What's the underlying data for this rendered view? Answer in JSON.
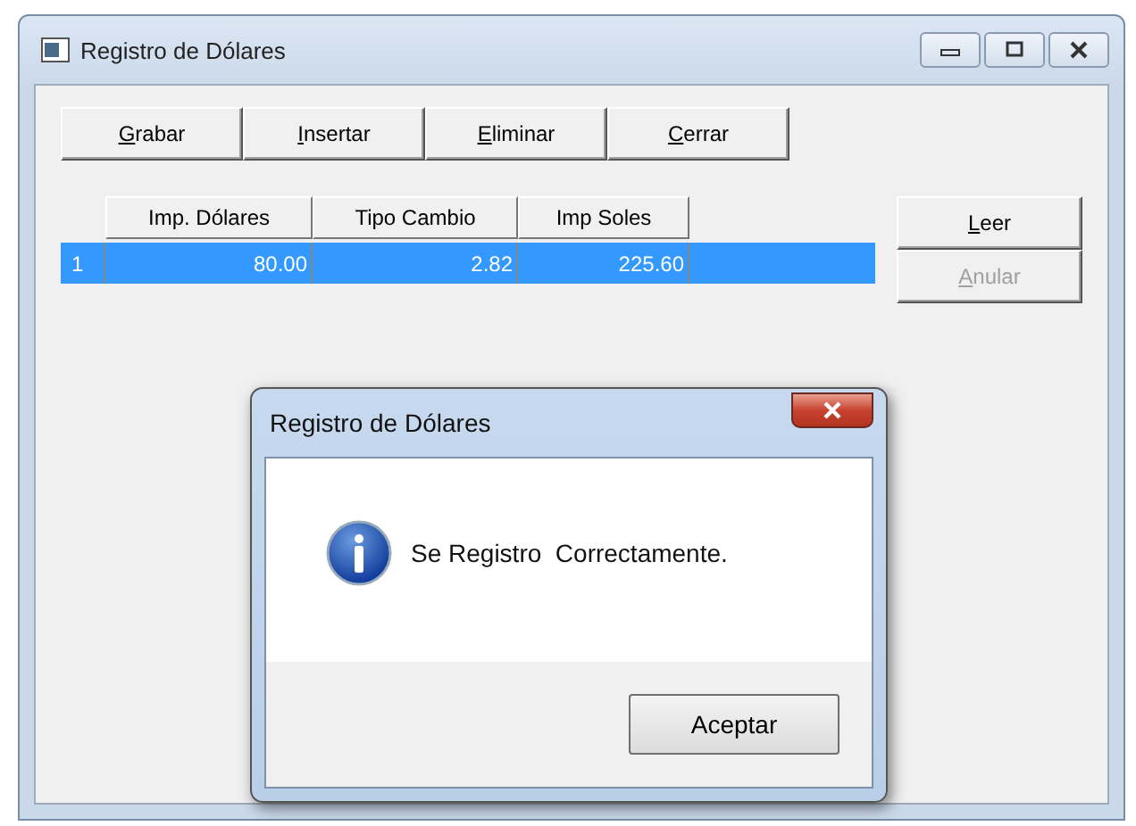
{
  "window": {
    "title": "Registro de Dólares"
  },
  "toolbar": [
    {
      "label": "Grabar",
      "access_key": true
    },
    {
      "label": "Insertar",
      "access_key": true
    },
    {
      "label": "Eliminar",
      "access_key": true
    },
    {
      "label": "Cerrar",
      "access_key": true
    }
  ],
  "table": {
    "columns": [
      "Imp. Dólares",
      "Tipo Cambio",
      "Imp Soles"
    ],
    "rows": [
      {
        "number": "1",
        "cells": [
          "80.00",
          "2.82",
          "225.60"
        ],
        "selected": true
      }
    ]
  },
  "side_buttons": [
    {
      "label": "Leer",
      "access_key": true,
      "disabled": false
    },
    {
      "label": "Anular",
      "access_key": true,
      "disabled": true
    }
  ],
  "dialog": {
    "title": "Registro de Dólares",
    "message": "Se Registro  Correctamente.",
    "button": "Aceptar"
  }
}
